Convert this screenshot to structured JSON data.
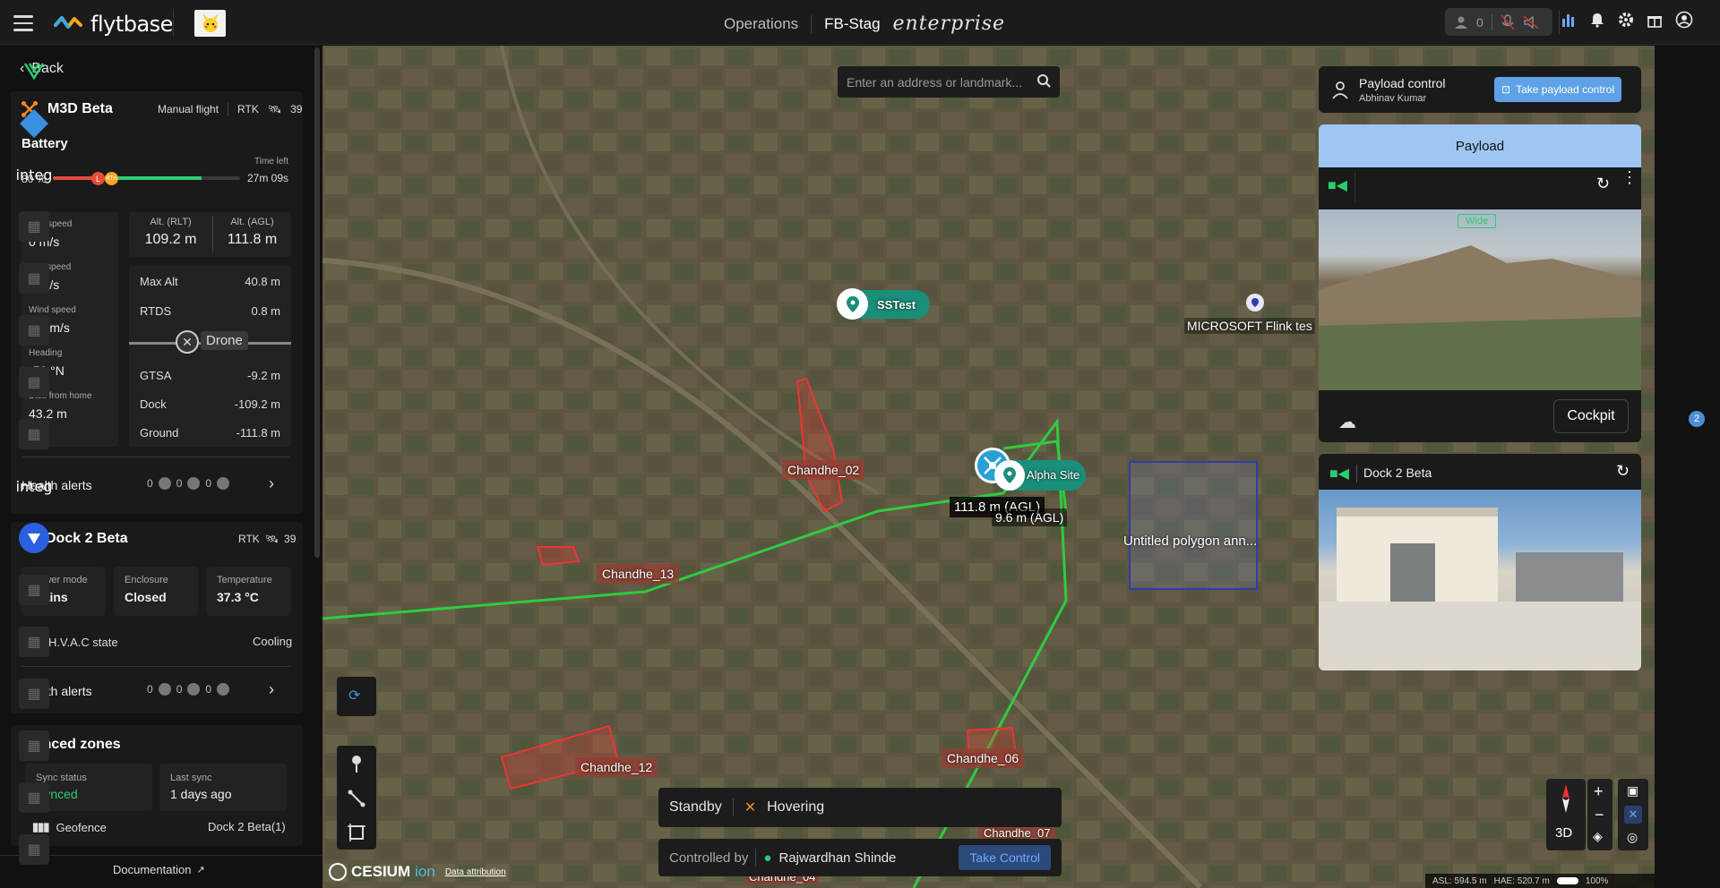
{
  "header": {
    "brand": "flytbase",
    "nav_operations": "Operations",
    "org": "FB-Stag",
    "edition": "enterprise",
    "user_count": "0"
  },
  "left": {
    "back": "Back",
    "drone": {
      "name": "M3D Beta",
      "mode": "Manual flight",
      "rtk": "RTK",
      "rtk_count": "39"
    },
    "battery": {
      "title": "Battery",
      "percent": "80 %",
      "percent_value": 80,
      "time_left_label": "Time left",
      "time_left": "27m 09s",
      "marker_l": "L",
      "marker_rth": "RTH"
    },
    "speeds": [
      {
        "label": "Hor. speed",
        "value": "0 m/s"
      },
      {
        "label": "Ver. speed",
        "value": "0 m/s"
      },
      {
        "label": "Wind speed",
        "value": "5.8 m/s"
      },
      {
        "label": "Heading",
        "value": "-56 °N"
      },
      {
        "label": "Dist. from home",
        "value": "43.2 m"
      }
    ],
    "alt_rlt": {
      "label": "Alt. (RLT)",
      "value": "109.2 m"
    },
    "alt_agl": {
      "label": "Alt. (AGL)",
      "value": "111.8 m"
    },
    "altrows": [
      {
        "label": "Max Alt",
        "value": "40.8 m"
      },
      {
        "label": "RTDS",
        "value": "0.8 m"
      },
      {
        "label": "GTSA",
        "value": "-9.2 m"
      },
      {
        "label": "Dock",
        "value": "-109.2 m"
      },
      {
        "label": "Ground",
        "value": "-111.8 m"
      }
    ],
    "drone_marker": "Drone",
    "health_alerts": "Health alerts",
    "health_counts": [
      "0",
      "0",
      "0"
    ],
    "dock": {
      "name": "Dock 2 Beta",
      "rtk": "RTK",
      "rtk_count": "39",
      "stats": [
        {
          "label": "Power mode",
          "value": "Mains"
        },
        {
          "label": "Enclosure",
          "value": "Closed"
        },
        {
          "label": "Temperature",
          "value": "37.3 °C"
        }
      ],
      "hvac_label": "H.V.A.C state",
      "hvac_value": "Cooling"
    },
    "dock_health_counts": [
      "0",
      "0",
      "0"
    ],
    "synced": {
      "title": "Synced zones",
      "status_label": "Sync status",
      "status_value": "Synced",
      "last_label": "Last sync",
      "last_value": "1 days ago",
      "geofence": "Geofence",
      "geofence_value": "Dock 2 Beta(1)"
    },
    "documentation": "Documentation"
  },
  "map": {
    "search_placeholder": "Enter an address or landmark...",
    "labels": {
      "sstest": "SSTest",
      "microsoft": "MICROSOFT Flink tes",
      "alpha": "Alpha Site",
      "agl": "111.8 m (AGL)",
      "agl2": "9.6 m (AGL)",
      "polygon": "Untitled polygon ann...",
      "c02": "Chandhe_02",
      "c13": "Chandhe_13",
      "c12": "Chandhe_12",
      "c06": "Chandhe_06",
      "c07": "Chandhe_07",
      "c04": "Chandhe_04"
    },
    "status": "Standby",
    "flight_state": "Hovering",
    "controlled_by": "Controlled by",
    "controller": "Rajwardhan Shinde",
    "take_control": "Take Control",
    "cesium": "CESIUM",
    "cesium_ion": "ion",
    "attribution": "Data attribution",
    "asl": "ASL: 594.5 m",
    "hae": "HAE: 520.7 m",
    "zoom": "100%",
    "mode3d": "3D"
  },
  "payload": {
    "title": "Payload control",
    "user": "Abhinav Kumar",
    "take": "Take payload control",
    "tab": "Payload",
    "lens": "Wide",
    "cockpit": "Cockpit"
  },
  "dockcam": {
    "title": "Dock 2 Beta"
  },
  "rightbar": {
    "badge": "2",
    "integ1": "integ",
    "integ2": "integ"
  }
}
